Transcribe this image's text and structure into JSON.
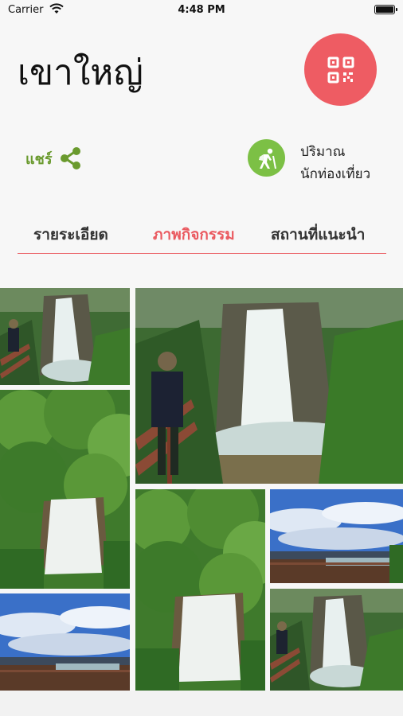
{
  "status": {
    "carrier": "Carrier",
    "time": "4:48 PM"
  },
  "header": {
    "title": "เขาใหญ่"
  },
  "actions": {
    "share_label": "แชร์",
    "visitors_label_line1": "ปริมาณ",
    "visitors_label_line2": "นักท่องเที่ยว"
  },
  "tabs": [
    {
      "label": "รายระเอียด",
      "active": false
    },
    {
      "label": "ภาพกิจกรรม",
      "active": true
    },
    {
      "label": "สถานที่แนะนำ",
      "active": false
    }
  ],
  "colors": {
    "accent": "#ea5a60",
    "qr_button": "#ee5c63",
    "share_green": "#6a9a2e",
    "visitors_green": "#7cc045"
  },
  "icons": {
    "qr": "qr-code-icon",
    "share": "share-icon",
    "visitors": "hiker-icon"
  },
  "photos": [
    {
      "subject": "waterfall-with-hiker"
    },
    {
      "subject": "waterfall-with-hiker"
    },
    {
      "subject": "waterfall-in-forest"
    },
    {
      "subject": "waterfall-in-forest"
    },
    {
      "subject": "sky-viewpoint"
    },
    {
      "subject": "sky-viewpoint"
    },
    {
      "subject": "waterfall-with-hiker"
    }
  ]
}
